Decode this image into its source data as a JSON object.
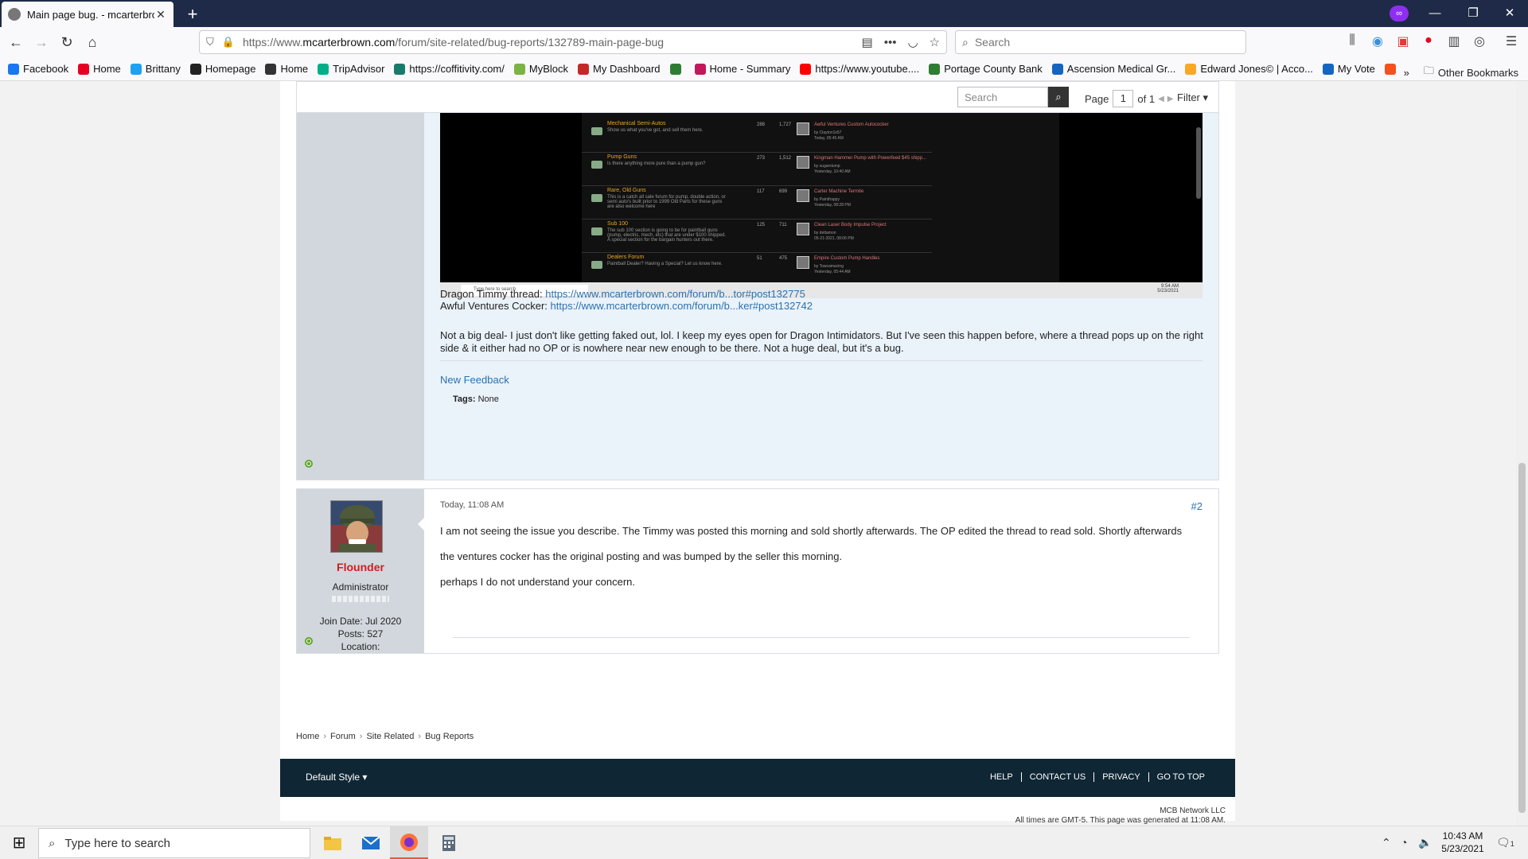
{
  "browser": {
    "tab_title": "Main page bug. - mcarterbrown.com",
    "tab_close": "✕",
    "new_tab": "+",
    "url_prefix": "https://www.",
    "url_domain": "mcarterbrown.com",
    "url_path": "/forum/site-related/bug-reports/132789-main-page-bug",
    "search_placeholder": "Search",
    "window": {
      "minimize": "—",
      "restore": "❐",
      "close": "✕"
    },
    "bookmarks": [
      {
        "label": "Facebook",
        "color": "#1877f2"
      },
      {
        "label": "Home",
        "color": "#e60023"
      },
      {
        "label": "Brittany",
        "color": "#1da1f2"
      },
      {
        "label": "Homepage",
        "color": "#222222"
      },
      {
        "label": "Home",
        "color": "#333333"
      },
      {
        "label": "TripAdvisor",
        "color": "#00af87"
      },
      {
        "label": "https://coffitivity.com/",
        "color": "#1a7a6a"
      },
      {
        "label": "MyBlock",
        "color": "#7cb342"
      },
      {
        "label": "My Dashboard",
        "color": "#c62828"
      },
      {
        "label": "",
        "color": "#2e7d32"
      },
      {
        "label": "Home - Summary",
        "color": "#c2185b"
      },
      {
        "label": "https://www.youtube....",
        "color": "#ff0000"
      },
      {
        "label": "Portage County Bank",
        "color": "#2e7d32"
      },
      {
        "label": "Ascension Medical Gr...",
        "color": "#1565c0"
      },
      {
        "label": "Edward Jones© | Acco...",
        "color": "#f9a825"
      },
      {
        "label": "My Vote",
        "color": "#1565c0"
      },
      {
        "label": "",
        "color": "#f4511e"
      }
    ],
    "bookmarks_overflow": "»",
    "other_bookmarks": "Other Bookmarks"
  },
  "toolbar": {
    "search_placeholder": "Search",
    "page_label": "Page",
    "page_current": "1",
    "page_of": "of 1",
    "filter_label": "Filter"
  },
  "embedded_screenshot": {
    "rows": [
      {
        "title": "Mechanical Semi-Autos",
        "desc": "Show us what you've got, and sell them here.",
        "n1": "288",
        "n2": "1,727",
        "last_title": "Awful Ventures Custom Autococker",
        "last_by": "by Clayton1x57",
        "last_date": "Today, 05:45 AM"
      },
      {
        "title": "Pump Guns",
        "desc": "Is there anything more pure than a pump gun?",
        "n1": "273",
        "n2": "1,512",
        "last_title": "Kingman Hammer Pump with Powerfeed $45 shipp...",
        "last_by": "by sugarslump",
        "last_date": "Yesterday, 10:40 AM"
      },
      {
        "title": "Rare, Old Guns",
        "desc": "This is a catch all sale forum for pump, double action, or semi auto's built prior to 1999 Old Parts for these guns are also welcome here",
        "n1": "117",
        "n2": "699",
        "last_title": "Carter Machine Termite",
        "last_by": "by Paintfrappy",
        "last_date": "Yesterday, 08:28 PM"
      },
      {
        "title": "Sub 100",
        "desc": "The sub 100 section is going to be for paintball guns (pump, electric, mech, etc) that are under $100 shipped. A special section for the bargain hunters out there.",
        "n1": "125",
        "n2": "711",
        "last_title": "Clean Laser Body Impulse Project",
        "last_by": "by dettamon",
        "last_date": "05-21-2021, 08:06 PM"
      },
      {
        "title": "Dealers Forum",
        "desc": "Paintball Dealer? Having a Special? Let us know here.",
        "n1": "51",
        "n2": "475",
        "last_title": "Empire Custom Pump Handles",
        "last_by": "by Towcamacing",
        "last_date": "Yesterday, 05:44 AM"
      }
    ],
    "taskbar_search": "Type here to search",
    "clock_time": "9:54 AM",
    "clock_date": "5/23/2021"
  },
  "post1": {
    "thread1_label": "Dragon Timmy thread:",
    "thread1_link": "https://www.mcarterbrown.com/forum/b...tor#post132775",
    "thread2_label": "Awful Ventures Cocker:",
    "thread2_link": "https://www.mcarterbrown.com/forum/b...ker#post132742",
    "body": "Not a big deal- I just don't like getting faked out, lol. I keep my eyes open for Dragon Intimidators. But I've seen this happen before, where a thread pops up on the right side & it either had no OP or is nowhere near new enough to be there. Not a huge deal, but it's a bug.",
    "new_feedback": "New Feedback",
    "tags_label": "Tags:",
    "tags_value": "None"
  },
  "post2": {
    "username": "Flounder",
    "role": "Administrator",
    "join_date": "Join Date: Jul 2020",
    "posts": "Posts: 527",
    "location": "Location:",
    "timestamp": "Today, 11:08 AM",
    "post_number": "#2",
    "line1": "I am not seeing the issue you describe. The Timmy was posted this morning and sold shortly afterwards. The OP edited the thread to read sold. Shortly afterwards",
    "line2": "the ventures cocker has the original posting and was bumped by the seller this morning.",
    "line3": "perhaps I do not understand your concern."
  },
  "breadcrumb": [
    "Home",
    "Forum",
    "Site Related",
    "Bug Reports"
  ],
  "footer": {
    "style_label": "Default Style",
    "links": [
      "HELP",
      "CONTACT US",
      "PRIVACY",
      "GO TO TOP"
    ],
    "company": "MCB Network LLC",
    "timezone_note": "All times are GMT-5. This page was generated at 11:08 AM."
  },
  "taskbar": {
    "search_placeholder": "Type here to search",
    "time": "10:43 AM",
    "date": "5/23/2021",
    "notification_count": "1"
  }
}
